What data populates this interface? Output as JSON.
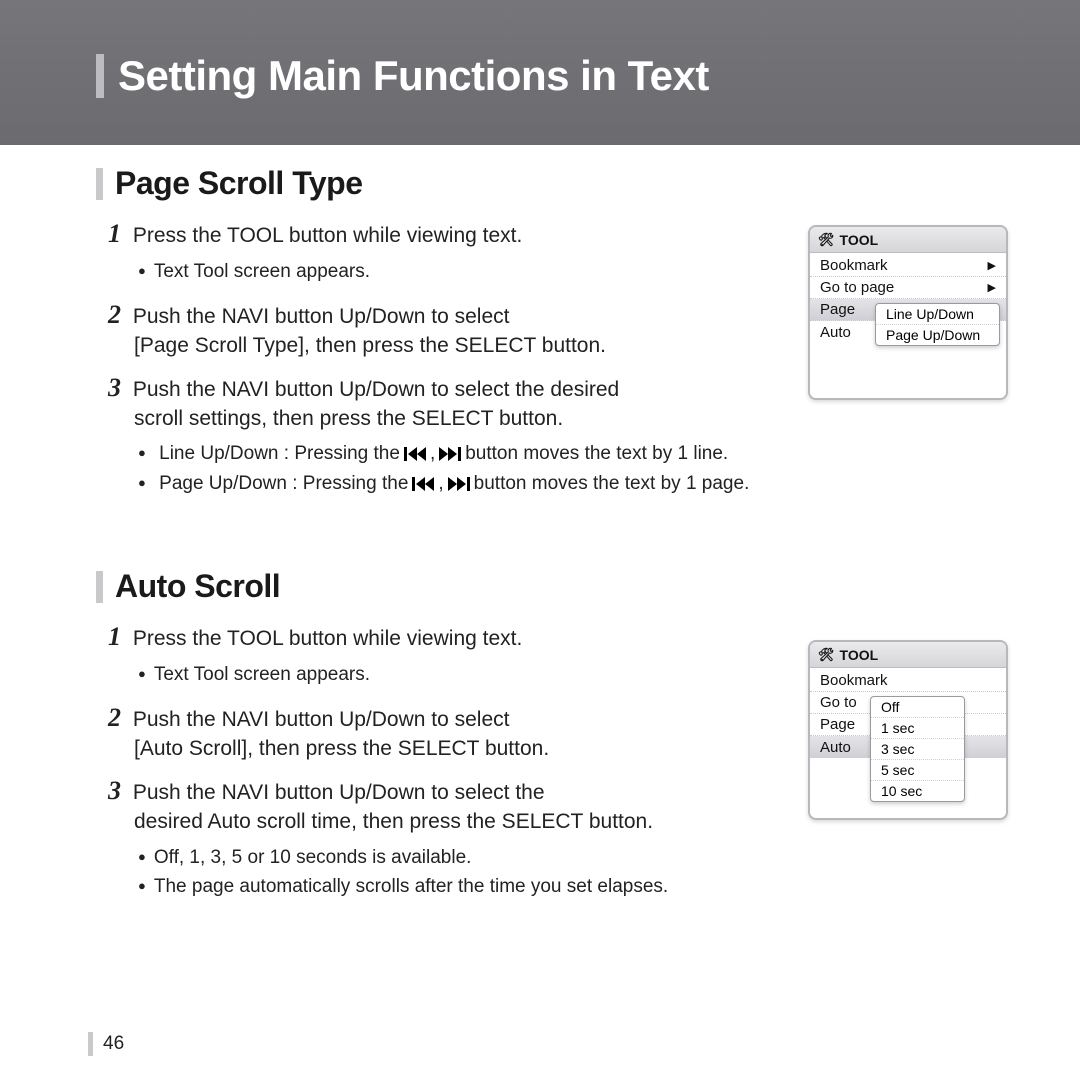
{
  "header": {
    "title": "Setting Main Functions in Text"
  },
  "page_number": "46",
  "sections": {
    "s1": {
      "title": "Page Scroll Type",
      "step1_num": "1",
      "step1_text": "Press the TOOL button while viewing text.",
      "step1_bullet": "Text Tool screen appears.",
      "step2_num": "2",
      "step2_a": "Push the NAVI button Up/Down to select",
      "step2_b": "[Page Scroll Type], then press the SELECT button.",
      "step3_num": "3",
      "step3_a": "Push the NAVI button Up/Down to select the desired",
      "step3_b": "scroll settings, then press the SELECT button.",
      "b_line_pre": "Line Up/Down : Pressing the",
      "b_line_mid": ",",
      "b_line_post": "button moves the text by 1 line.",
      "b_page_pre": "Page Up/Down : Pressing the",
      "b_page_mid": ",",
      "b_page_post": "button moves the text by 1 page."
    },
    "s2": {
      "title": "Auto Scroll",
      "step1_num": "1",
      "step1_text": "Press the TOOL button while viewing text.",
      "step1_bullet": "Text Tool screen appears.",
      "step2_num": "2",
      "step2_a": "Push the NAVI button Up/Down to select",
      "step2_b": "[Auto Scroll], then press the SELECT button.",
      "step3_num": "3",
      "step3_a": "Push the NAVI button Up/Down to select the",
      "step3_b": "desired Auto scroll time, then press the SELECT button.",
      "b1": "Off, 1, 3, 5 or 10 seconds is available.",
      "b2": "The page automatically scrolls after the time you set elapses."
    }
  },
  "tool_panel": {
    "title": "TOOL",
    "rows": {
      "bookmark": "Bookmark",
      "go_to_page": "Go to page",
      "page_scroll": "Page Scroll Type",
      "page_scroll_trunc": "Page",
      "auto_scroll": "Auto Scroll",
      "auto_scroll_trunc": "Auto",
      "bookmark_trunc": "Bookmark",
      "goto_trunc": "Go to"
    }
  },
  "popup1": {
    "opt1": "Line Up/Down",
    "opt2": "Page Up/Down"
  },
  "popup2": {
    "opt1": "Off",
    "opt2": "1 sec",
    "opt3": "3 sec",
    "opt4": "5 sec",
    "opt5": "10 sec"
  }
}
